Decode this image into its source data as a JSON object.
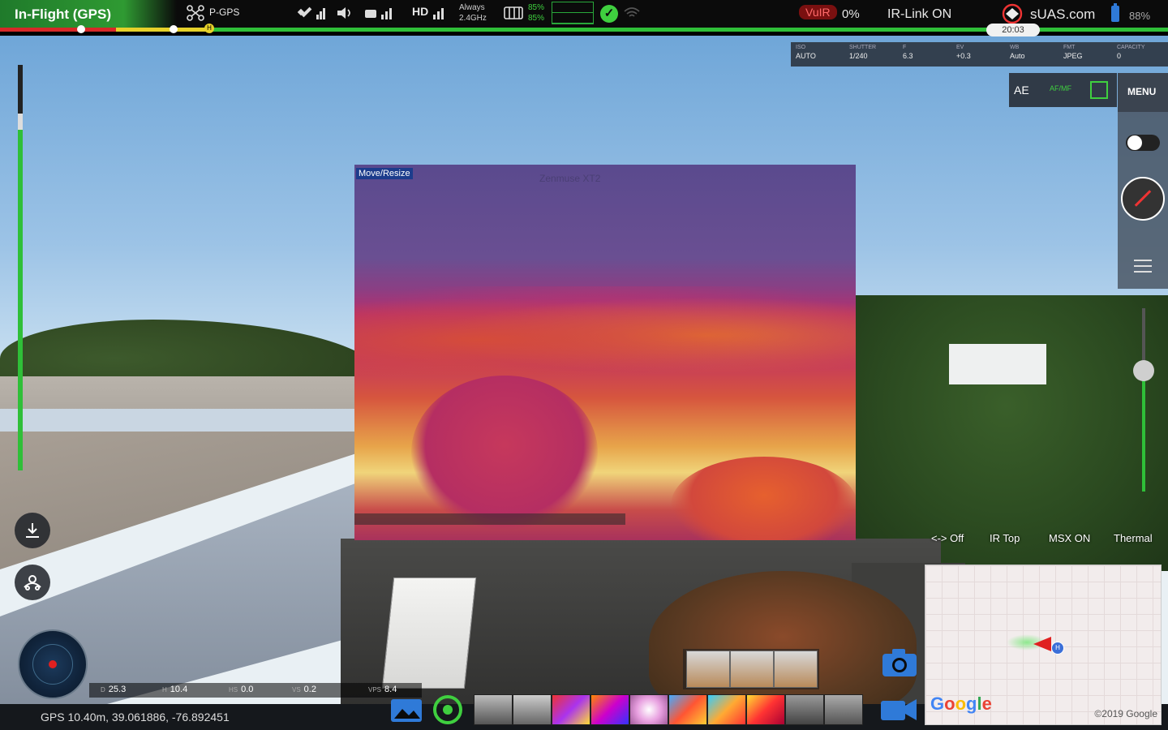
{
  "status": {
    "flight_state": "In-Flight (GPS)",
    "flight_mode": "P-GPS",
    "tx_quality": "HD",
    "frequency_line1": "Always",
    "frequency_line2": "2.4GHz",
    "battery_pct_top": "85%",
    "battery_pct_bottom": "85%",
    "vuir_label": "VuIR",
    "vuir_pct": "0%",
    "ir_link": "IR-Link ON",
    "brand": "sUAS.com",
    "device_battery": "88%",
    "flight_time": "20:03"
  },
  "flight_progress": {
    "red_fraction": 0.099,
    "yellow_fraction": 0.08
  },
  "camera_params": [
    {
      "key": "ISO",
      "value": "AUTO"
    },
    {
      "key": "SHUTTER",
      "value": "1/240"
    },
    {
      "key": "F",
      "value": "6.3"
    },
    {
      "key": "EV",
      "value": "+0.3"
    },
    {
      "key": "WB",
      "value": "Auto"
    },
    {
      "key": "FMT",
      "value": "JPEG"
    },
    {
      "key": "CAPACITY",
      "value": "0"
    }
  ],
  "controls": {
    "ae_label": "AE",
    "afmf_label": "AF/MF",
    "menu_label": "MENU"
  },
  "pip": {
    "move_resize_label": "Move/Resize",
    "center_label": "Zenmuse XT2"
  },
  "modes": {
    "pip_toggle": "<-> Off",
    "ir_position": "IR Top",
    "msx": "MSX ON",
    "palette": "Thermal"
  },
  "telemetry": [
    {
      "key": "D",
      "value": "25.3"
    },
    {
      "key": "H",
      "value": "10.4"
    },
    {
      "key": "HS",
      "value": "0.0"
    },
    {
      "key": "VS",
      "value": "0.2"
    },
    {
      "key": "VPS",
      "value": "8.4"
    }
  ],
  "gps": "GPS 10.40m, 39.061886, -76.892451",
  "map": {
    "logo": "Google",
    "copyright": "©2019 Google",
    "home_marker": "H"
  },
  "icons": {
    "drone_icon": "drone-icon",
    "satellite_icon": "satellite-icon",
    "speaker_icon": "speaker-icon",
    "signal_icon": "signal-icon",
    "check_icon": "check-icon",
    "wifi_icon": "wifi-icon"
  },
  "colors": {
    "ok_green": "#2fbf38",
    "warning_red": "#d62828",
    "warning_yellow": "#e6d12a",
    "accent_blue": "#3b6fd8"
  }
}
